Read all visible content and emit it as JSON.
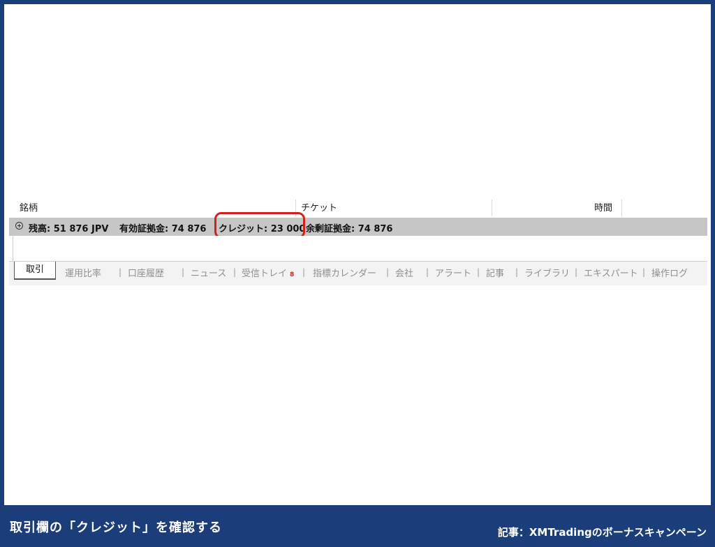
{
  "terminal": {
    "columns": {
      "symbol": "銘柄",
      "ticket": "チケット",
      "time": "時間"
    },
    "summary": {
      "balance": "残高: 51 876 JPV",
      "equity": "有効証拠金: 74 876",
      "credit": "クレジット: 23 000",
      "free_margin": "余剰証拠金: 74 876"
    },
    "tabs": [
      {
        "label": "取引",
        "active": true
      },
      {
        "label": "運用比率"
      },
      {
        "label": "口座履歴"
      },
      {
        "label": "ニュース"
      },
      {
        "label": "受信トレイ",
        "badge": "8"
      },
      {
        "label": "指標カレンダー"
      },
      {
        "label": "会社"
      },
      {
        "label": "アラート"
      },
      {
        "label": "記事"
      },
      {
        "label": "ライブラリ"
      },
      {
        "label": "エキスパート"
      },
      {
        "label": "操作ログ"
      }
    ],
    "tab_separator": "|"
  },
  "caption": {
    "title": "取引欄の「クレジット」を確認する",
    "reference": "記事：XMTradingのボーナスキャンペーン"
  },
  "colors": {
    "frame": "#1b3d7a",
    "highlight": "#d3201f",
    "summary_row": "#c6c6c6"
  }
}
